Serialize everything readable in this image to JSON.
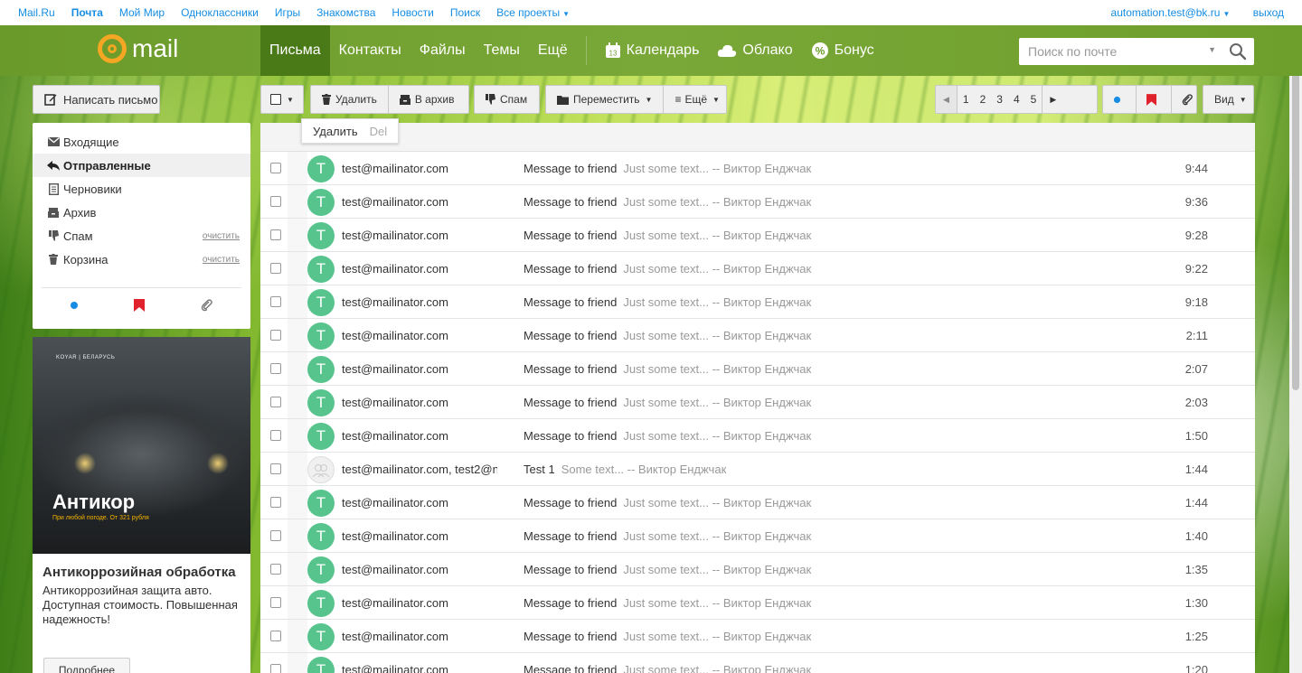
{
  "portal": {
    "links": [
      "Mail.Ru",
      "Почта",
      "Мой Мир",
      "Одноклассники",
      "Игры",
      "Знакомства",
      "Новости",
      "Поиск"
    ],
    "all_projects": "Все проекты",
    "user": "automation.test@bk.ru",
    "logout": "выход"
  },
  "header": {
    "logo_text": "mail",
    "nav": [
      "Письма",
      "Контакты",
      "Файлы",
      "Темы",
      "Ещё"
    ],
    "calendar": "Календарь",
    "calendar_day": "13",
    "cloud": "Облако",
    "bonus": "Бонус",
    "search_placeholder": "Поиск по почте"
  },
  "sidebar": {
    "compose": "Написать письмо",
    "folders": [
      {
        "label": "Входящие",
        "icon": "envelope-icon"
      },
      {
        "label": "Отправленные",
        "icon": "reply-icon"
      },
      {
        "label": "Черновики",
        "icon": "draft-icon"
      },
      {
        "label": "Архив",
        "icon": "archive-icon"
      },
      {
        "label": "Спам",
        "icon": "thumb-down-icon",
        "clean": "очистить"
      },
      {
        "label": "Корзина",
        "icon": "trash-icon",
        "clean": "очистить"
      }
    ],
    "active_folder": "Отправленные"
  },
  "ad": {
    "brand": "KOYAR | БЕЛАРУСЬ",
    "image_title": "Антикор",
    "image_sub": "При любой погоде. От 321 рубля",
    "title": "Антикоррозийная обработка",
    "text": "Антикоррозийная защита авто. Доступная стоимость. Повышенная надежность!",
    "button": "Подробнее"
  },
  "toolbar": {
    "delete": "Удалить",
    "archive": "В архив",
    "spam": "Спам",
    "move": "Переместить",
    "more": "Ещё",
    "pages": [
      "1",
      "2",
      "3",
      "4",
      "5"
    ],
    "view": "Вид"
  },
  "tooltip": {
    "label": "Удалить",
    "key": "Del"
  },
  "messages": [
    {
      "avatar": "T",
      "from": "test@mailinator.com",
      "subject": "Message to friend",
      "snippet": "Just some text... -- Виктор Енджчак",
      "time": "9:44"
    },
    {
      "avatar": "T",
      "from": "test@mailinator.com",
      "subject": "Message to friend",
      "snippet": "Just some text... -- Виктор Енджчак",
      "time": "9:36"
    },
    {
      "avatar": "T",
      "from": "test@mailinator.com",
      "subject": "Message to friend",
      "snippet": "Just some text... -- Виктор Енджчак",
      "time": "9:28"
    },
    {
      "avatar": "T",
      "from": "test@mailinator.com",
      "subject": "Message to friend",
      "snippet": "Just some text... -- Виктор Енджчак",
      "time": "9:22"
    },
    {
      "avatar": "T",
      "from": "test@mailinator.com",
      "subject": "Message to friend",
      "snippet": "Just some text... -- Виктор Енджчак",
      "time": "9:18"
    },
    {
      "avatar": "T",
      "from": "test@mailinator.com",
      "subject": "Message to friend",
      "snippet": "Just some text... -- Виктор Енджчак",
      "time": "2:11"
    },
    {
      "avatar": "T",
      "from": "test@mailinator.com",
      "subject": "Message to friend",
      "snippet": "Just some text... -- Виктор Енджчак",
      "time": "2:07"
    },
    {
      "avatar": "T",
      "from": "test@mailinator.com",
      "subject": "Message to friend",
      "snippet": "Just some text... -- Виктор Енджчак",
      "time": "2:03"
    },
    {
      "avatar": "T",
      "from": "test@mailinator.com",
      "subject": "Message to friend",
      "snippet": "Just some text... -- Виктор Енджчак",
      "time": "1:50"
    },
    {
      "avatar": "",
      "from": "test@mailinator.com, test2@n",
      "subject": "Test 1",
      "snippet": "Some text... -- Виктор Енджчак",
      "time": "1:44"
    },
    {
      "avatar": "T",
      "from": "test@mailinator.com",
      "subject": "Message to friend",
      "snippet": "Just some text... -- Виктор Енджчак",
      "time": "1:44"
    },
    {
      "avatar": "T",
      "from": "test@mailinator.com",
      "subject": "Message to friend",
      "snippet": "Just some text... -- Виктор Енджчак",
      "time": "1:40"
    },
    {
      "avatar": "T",
      "from": "test@mailinator.com",
      "subject": "Message to friend",
      "snippet": "Just some text... -- Виктор Енджчак",
      "time": "1:35"
    },
    {
      "avatar": "T",
      "from": "test@mailinator.com",
      "subject": "Message to friend",
      "snippet": "Just some text... -- Виктор Енджчак",
      "time": "1:30"
    },
    {
      "avatar": "T",
      "from": "test@mailinator.com",
      "subject": "Message to friend",
      "snippet": "Just some text... -- Виктор Енджчак",
      "time": "1:25"
    },
    {
      "avatar": "T",
      "from": "test@mailinator.com",
      "subject": "Message to friend",
      "snippet": "Just some text... -- Виктор Енджчак",
      "time": "1:20"
    }
  ],
  "colors": {
    "link": "#168de2",
    "header": "#7aa838",
    "avatar": "#57c48e",
    "flag": "#e0222c",
    "unread": "#168de2"
  }
}
